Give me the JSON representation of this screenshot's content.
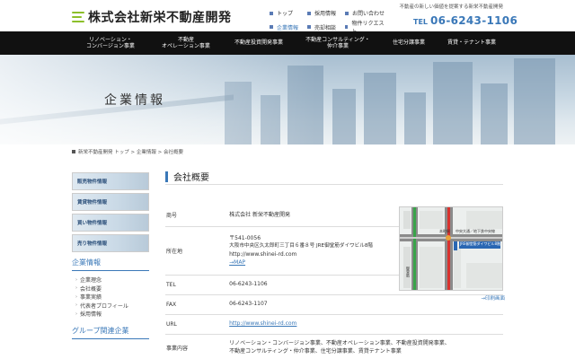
{
  "header": {
    "logo_text": "株式会社新栄不動産開発",
    "tagline": "不動産の新しい価値を提案する新栄不動産開発",
    "links": [
      {
        "label": "トップ",
        "current": false
      },
      {
        "label": "採用情報",
        "current": false
      },
      {
        "label": "お問い合わせ",
        "current": false
      },
      {
        "label": "企業情報",
        "current": true
      },
      {
        "label": "売却相談",
        "current": false
      },
      {
        "label": "物件リクエスト",
        "current": false
      }
    ],
    "tel_label": "TEL",
    "tel_number": "06-6243-1106"
  },
  "nav": [
    "リノベーション・\nコンバージョン事業",
    "不動産\nオペレーション事業",
    "不動産投資開発事業",
    "不動産コンサルティング・\n仲介事業",
    "住宅分譲事業",
    "賃貸・テナント事業"
  ],
  "hero": {
    "title": "企業情報"
  },
  "breadcrumb": "新栄不動産開発 トップ > 企業情報 > 会社概要",
  "sidebar": {
    "banners": [
      "販売物件情報",
      "賃貸物件情報",
      "買い物件情報",
      "売り物件情報"
    ],
    "section1_title": "企業情報",
    "section1_links": [
      "企業理念",
      "会社概要",
      "事業実績",
      "代表者プロフィール",
      "採用情報"
    ],
    "section2_title": "グループ関連企業"
  },
  "main": {
    "title": "会社概要",
    "rows": [
      {
        "key": "商号",
        "lines": [
          "株式会社 新栄不動産開発"
        ]
      },
      {
        "key": "所在地",
        "lines": [
          "〒541-0056",
          "大阪市中央区久太郎町三丁目６番８号 JRE御堂筋ダイワビル8階",
          "http://www.shinei-rd.com"
        ],
        "link": "→MAP"
      },
      {
        "key": "TEL",
        "lines": [
          "06-6243-1106"
        ]
      },
      {
        "key": "FAX",
        "lines": [
          "06-6243-1107"
        ]
      },
      {
        "key": "URL",
        "lines": [],
        "link": "http://www.shinei-rd.com"
      },
      {
        "key": "事業内容",
        "lines": [
          "リノベーション・コンバージョン事業、不動産オペレーション事業、不動産投資開発事業、",
          "不動産コンサルティング・仲介事業、住宅分譲事業、賃貸テナント事業"
        ]
      }
    ],
    "map": {
      "label_station": "本町駅",
      "label_building": "JRE御堂筋ダイワビル8階",
      "label_road": "中央大通／地下鉄中央線",
      "label_midosuji": "御堂筋",
      "caption": "→印刷画面"
    }
  }
}
